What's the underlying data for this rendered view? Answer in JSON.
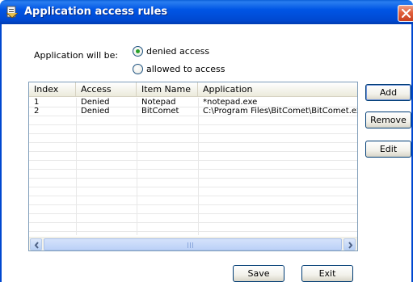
{
  "window": {
    "title": "Application access rules",
    "title_bar_color": "#0055e5",
    "close_icon": "close-icon"
  },
  "mode": {
    "label": "Application will be:",
    "options": [
      {
        "label": "denied access",
        "selected": true
      },
      {
        "label": "allowed to access",
        "selected": false
      }
    ]
  },
  "table": {
    "columns": [
      "Index",
      "Access",
      "Item Name",
      "Application"
    ],
    "rows": [
      {
        "index": "1",
        "access": "Denied",
        "item_name": "Notepad",
        "application": "*notepad.exe"
      },
      {
        "index": "2",
        "access": "Denied",
        "item_name": "BitComet",
        "application": "C:\\Program Files\\BitComet\\BitComet.exe"
      }
    ]
  },
  "side_buttons": {
    "add": "Add",
    "remove": "Remove",
    "edit": "Edit"
  },
  "footer_buttons": {
    "save": "Save",
    "exit": "Exit"
  }
}
